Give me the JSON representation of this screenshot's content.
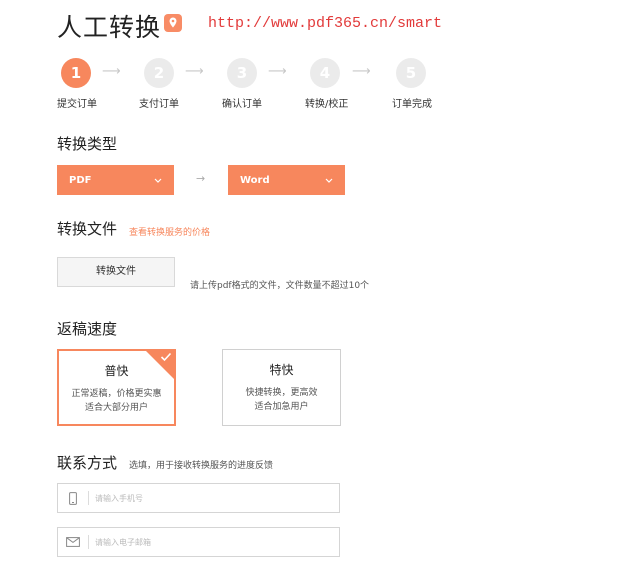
{
  "header": {
    "title": "人工转换",
    "url": "http://www.pdf365.cn/smart",
    "accent": "#f7875d"
  },
  "steps": [
    {
      "num": "1",
      "label": "提交订单",
      "active": true
    },
    {
      "num": "2",
      "label": "支付订单",
      "active": false
    },
    {
      "num": "3",
      "label": "确认订单",
      "active": false
    },
    {
      "num": "4",
      "label": "转换/校正",
      "active": false
    },
    {
      "num": "5",
      "label": "订单完成",
      "active": false
    }
  ],
  "step_arrow": "⟶",
  "conversion_type": {
    "title": "转换类型",
    "from": "PDF",
    "to": "Word",
    "arrow": "→"
  },
  "file": {
    "title": "转换文件",
    "price_link": "查看转换服务的价格",
    "button": "转换文件",
    "note": "请上传pdf格式的文件，文件数量不超过10个"
  },
  "speed": {
    "title": "返稿速度",
    "options": [
      {
        "name": "普快",
        "desc1": "正常返稿，价格更实惠",
        "desc2": "适合大部分用户",
        "selected": true
      },
      {
        "name": "特快",
        "desc1": "快捷转换，更高效",
        "desc2": "适合加急用户",
        "selected": false
      }
    ]
  },
  "contact": {
    "title": "联系方式",
    "hint": "选填，用于接收转换服务的进度反馈",
    "phone_placeholder": "请输入手机号",
    "email_placeholder": "请输入电子邮箱"
  }
}
